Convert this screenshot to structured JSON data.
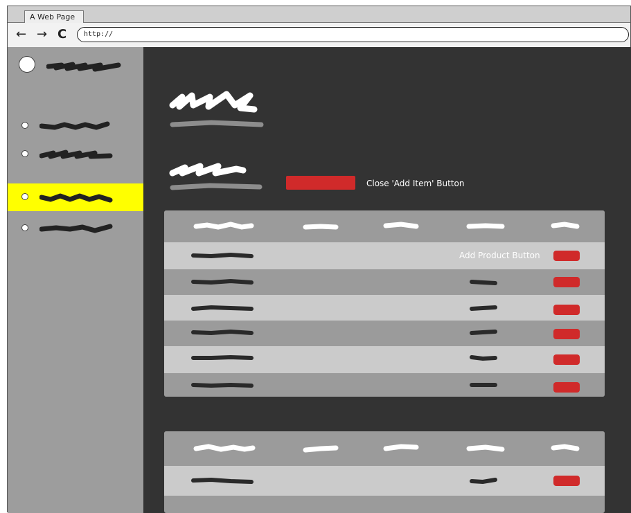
{
  "browser": {
    "tab_title": "A Web Page",
    "address": "http://",
    "back_label": "←",
    "forward_label": "→",
    "reload_label": "C"
  },
  "sidebar": {
    "active_index": 2,
    "items": [
      {
        "index": 0
      },
      {
        "index": 1
      },
      {
        "index": 2
      },
      {
        "index": 3
      }
    ]
  },
  "main": {
    "close_add_item_label": "Close 'Add Item' Button",
    "add_product_label": "Add Product Button"
  },
  "colors": {
    "sidebar_bg": "#9d9d9d",
    "main_bg": "#333333",
    "active_item": "#ffff00",
    "button_red": "#d02a2a",
    "row_light": "#cbcbcb",
    "row_dark": "#9b9b9b"
  }
}
